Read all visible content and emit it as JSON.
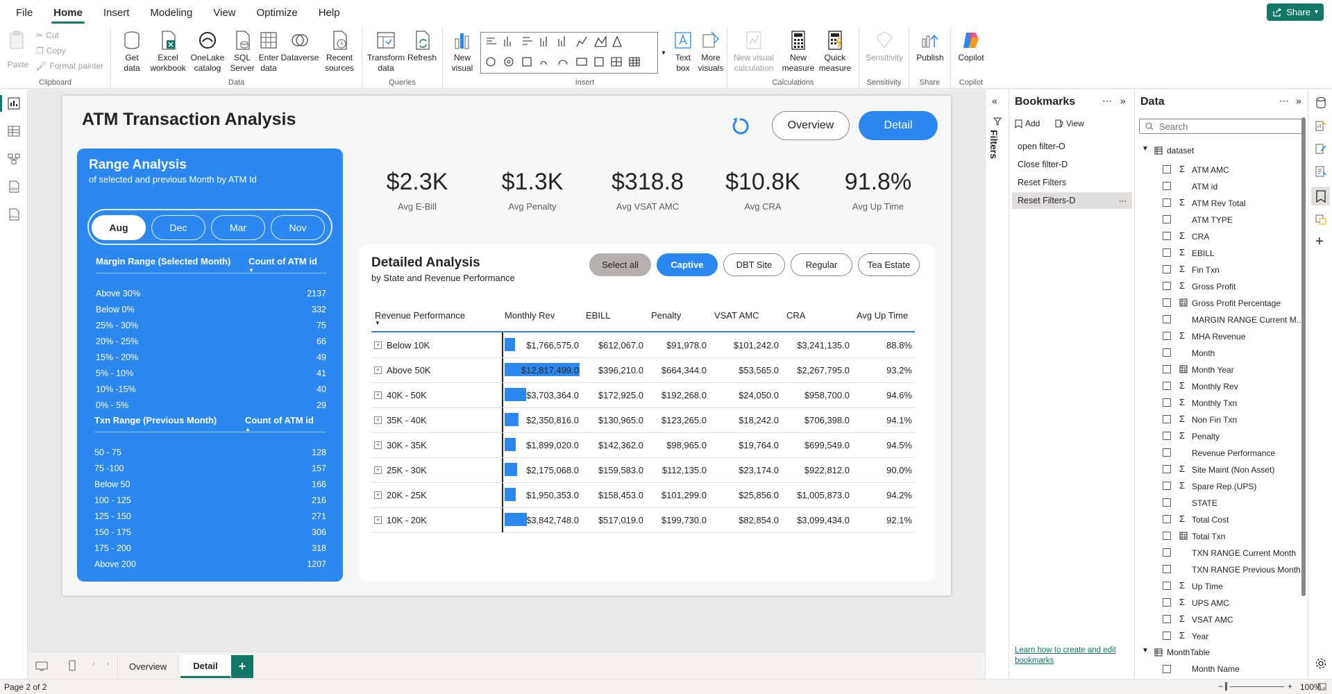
{
  "menu": {
    "items": [
      "File",
      "Home",
      "Insert",
      "Modeling",
      "View",
      "Optimize",
      "Help"
    ],
    "active": "Home",
    "share": "Share"
  },
  "ribbon": {
    "clipboard": {
      "paste": "Paste",
      "cut": "Cut",
      "copy": "Copy",
      "format_painter": "Format painter",
      "label": "Clipboard"
    },
    "data": {
      "get_data": "Get data",
      "excel": "Excel workbook",
      "onelake": "OneLake catalog",
      "sql": "SQL Server",
      "enter": "Enter data",
      "dataverse": "Dataverse",
      "recent": "Recent sources",
      "label": "Data"
    },
    "queries": {
      "transform": "Transform data",
      "refresh": "Refresh",
      "label": "Queries"
    },
    "insert": {
      "new_visual": "New visual",
      "text_box": "Text box",
      "more_visuals": "More visuals",
      "label": "Insert"
    },
    "calculations": {
      "new_visual_calc": "New visual calculation",
      "new_measure": "New measure",
      "quick_measure": "Quick measure",
      "label": "Calculations"
    },
    "sensitivity": {
      "btn": "Sensitivity",
      "label": "Sensitivity"
    },
    "share": {
      "publish": "Publish",
      "label": "Share"
    },
    "copilot": {
      "btn": "Copilot",
      "label": "Copilot"
    }
  },
  "report": {
    "title": "ATM Transaction Analysis",
    "nav": {
      "overview": "Overview",
      "detail": "Detail"
    },
    "range_panel": {
      "title": "Range Analysis",
      "subtitle": "of selected and previous Month by ATM Id",
      "months": [
        "Aug",
        "Dec",
        "Mar",
        "Nov"
      ],
      "selected_month": "Aug",
      "margin_header": "Margin Range (Selected Month)",
      "margin_count_header": "Count of ATM id",
      "margin_rows": [
        {
          "label": "Above 30%",
          "count": "2137"
        },
        {
          "label": "Below 0%",
          "count": "332"
        },
        {
          "label": "25% - 30%",
          "count": "75"
        },
        {
          "label": "20% - 25%",
          "count": "66"
        },
        {
          "label": "15% - 20%",
          "count": "49"
        },
        {
          "label": "5% - 10%",
          "count": "41"
        },
        {
          "label": "10% -15%",
          "count": "40"
        },
        {
          "label": "0% - 5%",
          "count": "29"
        }
      ],
      "txn_header": "Txn Range (Previous Month)",
      "txn_count_header": "Count of ATM id",
      "txn_rows": [
        {
          "label": "50 - 75",
          "count": "128"
        },
        {
          "label": "75 -100",
          "count": "157"
        },
        {
          "label": "Below 50",
          "count": "166"
        },
        {
          "label": "100 - 125",
          "count": "216"
        },
        {
          "label": "125 - 150",
          "count": "271"
        },
        {
          "label": "150 - 175",
          "count": "306"
        },
        {
          "label": "175 - 200",
          "count": "318"
        },
        {
          "label": "Above 200",
          "count": "1207"
        }
      ]
    },
    "kpis": [
      {
        "value": "$2.3K",
        "label": "Avg E-Bill"
      },
      {
        "value": "$1.3K",
        "label": "Avg Penalty"
      },
      {
        "value": "$318.8",
        "label": "Avg VSAT AMC"
      },
      {
        "value": "$10.8K",
        "label": "Avg CRA"
      },
      {
        "value": "91.8%",
        "label": "Avg Up Time"
      }
    ],
    "detail": {
      "title": "Detailed Analysis",
      "subtitle": "by State and Revenue Performance",
      "segments": [
        "Select all",
        "Captive",
        "DBT Site",
        "Regular",
        "Tea Estate"
      ],
      "selected_segment": "Captive",
      "columns": [
        "Revenue Performance",
        "Monthly Rev",
        "EBILL",
        "Penalty",
        "VSAT AMC",
        "CRA",
        "Avg Up Time"
      ],
      "rows": [
        {
          "label": "Below 10K",
          "rev": "$1,766,575.0",
          "rev_num": 1766575,
          "ebill": "$612,067.0",
          "penalty": "$91,978.0",
          "vsat": "$101,242.0",
          "cra": "$3,241,135.0",
          "uptime": "88.8%"
        },
        {
          "label": "Above 50K",
          "rev": "$12,817,499.0",
          "rev_num": 12817499,
          "ebill": "$396,210.0",
          "penalty": "$664,344.0",
          "vsat": "$53,565.0",
          "cra": "$2,267,795.0",
          "uptime": "93.2%"
        },
        {
          "label": "40K - 50K",
          "rev": "$3,703,364.0",
          "rev_num": 3703364,
          "ebill": "$172,925.0",
          "penalty": "$192,268.0",
          "vsat": "$24,050.0",
          "cra": "$958,700.0",
          "uptime": "94.6%"
        },
        {
          "label": "35K - 40K",
          "rev": "$2,350,816.0",
          "rev_num": 2350816,
          "ebill": "$130,965.0",
          "penalty": "$123,265.0",
          "vsat": "$18,242.0",
          "cra": "$706,398.0",
          "uptime": "94.1%"
        },
        {
          "label": "30K - 35K",
          "rev": "$1,899,020.0",
          "rev_num": 1899020,
          "ebill": "$142,362.0",
          "penalty": "$98,965.0",
          "vsat": "$19,764.0",
          "cra": "$699,549.0",
          "uptime": "94.5%"
        },
        {
          "label": "25K - 30K",
          "rev": "$2,175,068.0",
          "rev_num": 2175068,
          "ebill": "$159,583.0",
          "penalty": "$112,135.0",
          "vsat": "$23,174.0",
          "cra": "$922,812.0",
          "uptime": "90.0%"
        },
        {
          "label": "20K - 25K",
          "rev": "$1,950,353.0",
          "rev_num": 1950353,
          "ebill": "$158,453.0",
          "penalty": "$101,299.0",
          "vsat": "$25,856.0",
          "cra": "$1,005,873.0",
          "uptime": "94.2%"
        },
        {
          "label": "10K - 20K",
          "rev": "$3,842,748.0",
          "rev_num": 3842748,
          "ebill": "$517,019.0",
          "penalty": "$199,730.0",
          "vsat": "$82,854.0",
          "cra": "$3,099,434.0",
          "uptime": "92.1%"
        }
      ]
    }
  },
  "filters_label": "Filters",
  "bookmarks": {
    "title": "Bookmarks",
    "add": "Add",
    "view": "View",
    "items": [
      "open filter-O",
      "Close filter-D",
      "Reset Filters",
      "Reset Filters-D"
    ],
    "selected": "Reset Filters-D",
    "help_link": "Learn how to create and edit bookmarks"
  },
  "data_pane": {
    "title": "Data",
    "search_placeholder": "Search",
    "table": "dataset",
    "fields": [
      {
        "name": "ATM AMC",
        "sigma": true
      },
      {
        "name": "ATM id",
        "sigma": false
      },
      {
        "name": "ATM Rev Total",
        "sigma": true
      },
      {
        "name": "ATM TYPE",
        "sigma": false
      },
      {
        "name": "CRA",
        "sigma": true
      },
      {
        "name": "EBILL",
        "sigma": true
      },
      {
        "name": "Fin Txn",
        "sigma": true
      },
      {
        "name": "Gross Profit",
        "sigma": true
      },
      {
        "name": "Gross Profit Percentage",
        "sigma": false,
        "calc": true
      },
      {
        "name": "MARGIN RANGE Current M...",
        "sigma": false
      },
      {
        "name": "MHA Revenue",
        "sigma": true
      },
      {
        "name": "Month",
        "sigma": false
      },
      {
        "name": "Month Year",
        "sigma": false,
        "calc": true
      },
      {
        "name": "Monthly Rev",
        "sigma": true
      },
      {
        "name": "Monthly Txn",
        "sigma": true
      },
      {
        "name": "Non Fin Txn",
        "sigma": true
      },
      {
        "name": "Penalty",
        "sigma": true
      },
      {
        "name": "Revenue Performance",
        "sigma": false
      },
      {
        "name": "Site Maint (Non Asset)",
        "sigma": true
      },
      {
        "name": "Spare Rep.(UPS)",
        "sigma": true
      },
      {
        "name": "STATE",
        "sigma": false
      },
      {
        "name": "Total Cost",
        "sigma": true
      },
      {
        "name": "Total Txn",
        "sigma": false,
        "calc": true
      },
      {
        "name": "TXN RANGE Current Month",
        "sigma": false
      },
      {
        "name": "TXN RANGE Previous Month",
        "sigma": false
      },
      {
        "name": "Up Time",
        "sigma": true
      },
      {
        "name": "UPS AMC",
        "sigma": true
      },
      {
        "name": "VSAT AMC",
        "sigma": true
      },
      {
        "name": "Year",
        "sigma": true
      }
    ],
    "table2": "MonthTable",
    "table2_fields": [
      "Month Name"
    ]
  },
  "pages": {
    "tabs": [
      "Overview",
      "Detail"
    ],
    "active": "Detail",
    "add": "+"
  },
  "status": {
    "page": "Page 2 of 2",
    "zoom": "100%"
  },
  "colors": {
    "accent": "#2b88f0",
    "brand": "#117865"
  }
}
